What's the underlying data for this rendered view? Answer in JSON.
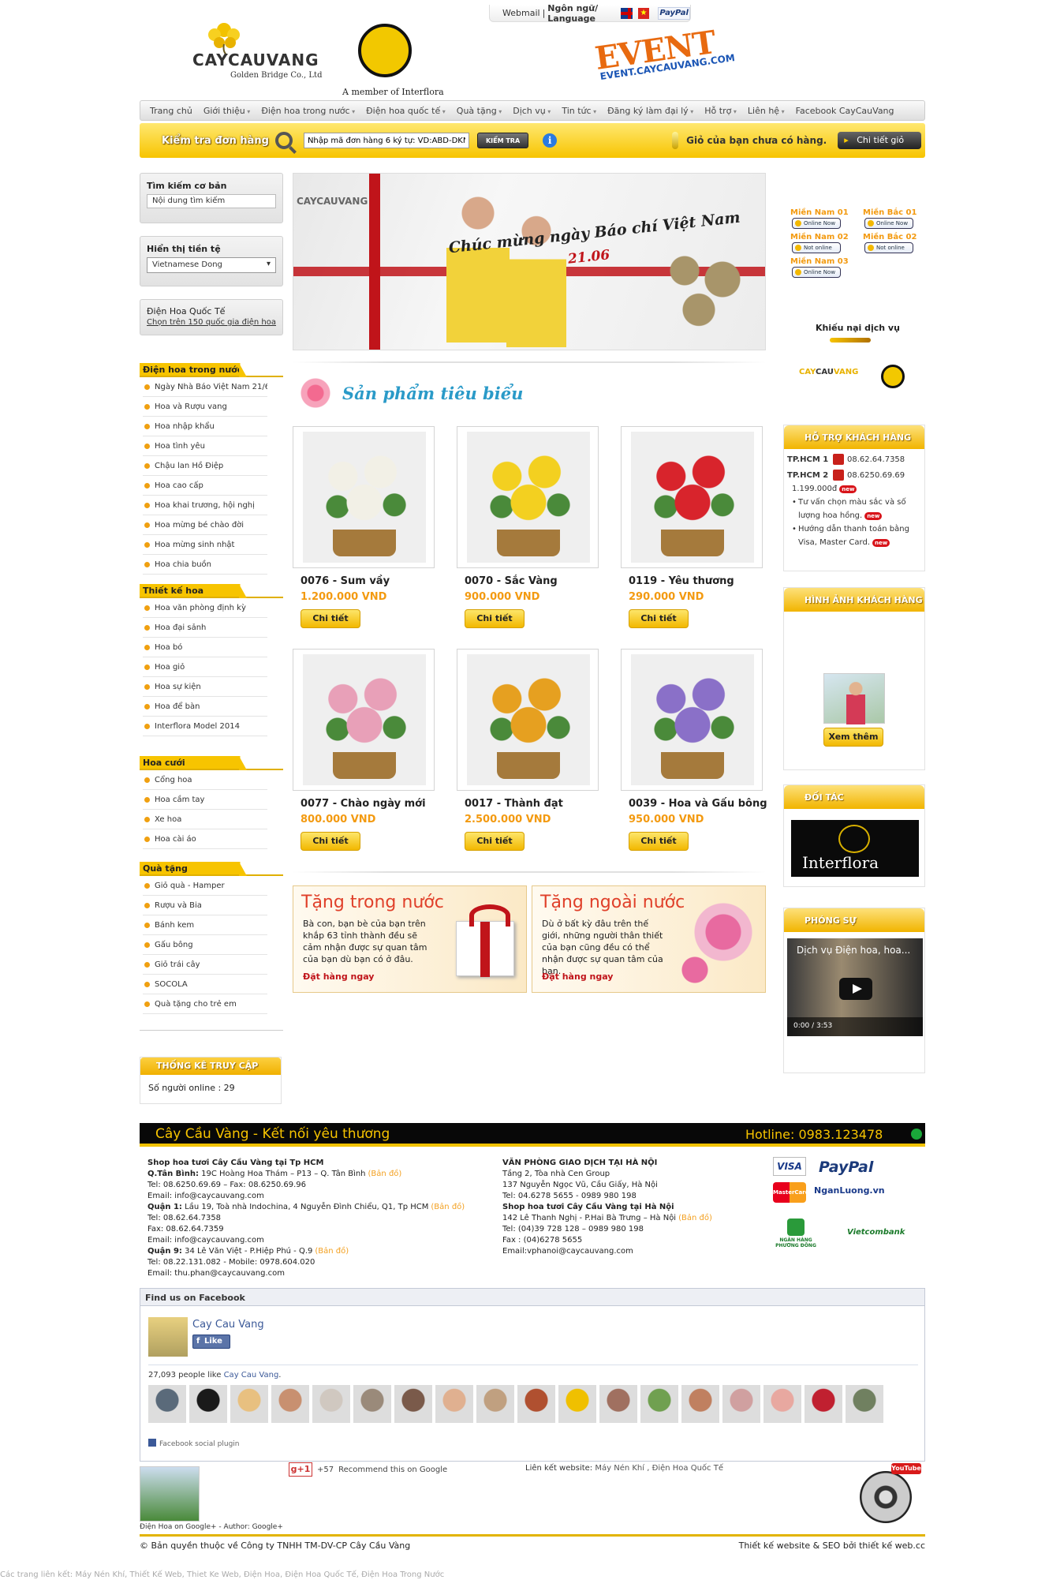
{
  "topbar": {
    "webmail": "Webmail",
    "language": "Ngôn ngữ/ Language",
    "paypal": "PayPal"
  },
  "header": {
    "logo_main": "CAYCAUVANG",
    "logo_sub": "Golden Bridge Co., Ltd",
    "interflora_caption": "A member of Interflora",
    "event_logo": "EVENT",
    "event_url": "EVENT.CAYCAUVANG.COM"
  },
  "nav": [
    {
      "label": "Trang chủ",
      "dropdown": false
    },
    {
      "label": "Giới thiệu",
      "dropdown": true
    },
    {
      "label": "Điện hoa trong nước",
      "dropdown": true
    },
    {
      "label": "Điện hoa quốc tế",
      "dropdown": true
    },
    {
      "label": "Quà tặng",
      "dropdown": true
    },
    {
      "label": "Dịch vụ",
      "dropdown": true
    },
    {
      "label": "Tin tức",
      "dropdown": true
    },
    {
      "label": "Đăng ký làm đại lý",
      "dropdown": true
    },
    {
      "label": "Hỗ trợ",
      "dropdown": true
    },
    {
      "label": "Liên hệ",
      "dropdown": true
    },
    {
      "label": "Facebook CayCauVang",
      "dropdown": false
    }
  ],
  "order_bar": {
    "label": "Kiểm tra đơn hàng",
    "input_placeholder": "Nhập mã đơn hàng 6 ký tự: VD:ABD-DKN",
    "check_button": "KIỂM TRA",
    "cart_text": "Giỏ của bạn chưa có hàng.",
    "detail_button": "Chi tiết giỏ"
  },
  "sidebar": {
    "search_title": "Tìm kiếm cơ bản",
    "search_placeholder": "Nội dung tìm kiếm",
    "currency_title": "Hiển thị tiền tệ",
    "currency_value": "Vietnamese Dong",
    "intl_title": "Điện Hoa Quốc Tế",
    "intl_link": "Chọn trên 150 quốc gia điện hoa",
    "categories": [
      {
        "title": "Điện hoa trong nước",
        "items": [
          "Ngày Nhà Báo Việt Nam 21/6",
          "Hoa và Rượu vang",
          "Hoa nhập khẩu",
          "Hoa tình yêu",
          "Chậu lan Hồ Điệp",
          "Hoa cao cấp",
          "Hoa khai trương, hội nghị",
          "Hoa mừng bé chào đời",
          "Hoa mừng sinh nhật",
          "Hoa chia buồn"
        ]
      },
      {
        "title": "Thiết kế hoa",
        "items": [
          "Hoa văn phòng định kỳ",
          "Hoa đại sảnh",
          "Hoa bó",
          "Hoa giỏ",
          "Hoa sự kiện",
          "Hoa để bàn",
          "Interflora Model 2014"
        ]
      },
      {
        "title": "Hoa cưới",
        "items": [
          "Cổng hoa",
          "Hoa cầm tay",
          "Xe hoa",
          "Hoa cài áo"
        ]
      },
      {
        "title": "Quà tặng",
        "items": [
          "Giỏ quà - Hamper",
          "Rượu và Bia",
          "Bánh kem",
          "Gấu bông",
          "Giỏ trái cây",
          "SOCOLA",
          "Quà tặng cho trẻ em"
        ]
      }
    ],
    "stats_title": "THỐNG KÊ TRUY CẬP",
    "stats_online": "Số người online : 29"
  },
  "banner": {
    "brand": "CAYCAUVANG",
    "message": "Chúc mừng ngày Báo chí Việt Nam",
    "date": "21.06"
  },
  "support_status": [
    {
      "name": "Miền Nam 01",
      "status": "Online Now"
    },
    {
      "name": "Miền Bắc 01",
      "status": "Online Now"
    },
    {
      "name": "Miền Nam 02",
      "status": "Not online"
    },
    {
      "name": "Miền Bắc 02",
      "status": "Not online"
    },
    {
      "name": "Miền Nam 03",
      "status": "Online Now"
    }
  ],
  "complaint": "Khiếu nại dịch vụ",
  "products_title": "Sản phẩm tiêu biểu",
  "products": [
    {
      "name": "0076 - Sum vầy",
      "price": "1.200.000 VND",
      "button": "Chi tiết",
      "color": "#f2f0e6"
    },
    {
      "name": "0070 - Sắc Vàng",
      "price": "900.000 VND",
      "button": "Chi tiết",
      "color": "#f3d020"
    },
    {
      "name": "0119 - Yêu thương",
      "price": "290.000 VND",
      "button": "Chi tiết",
      "color": "#d8242c"
    },
    {
      "name": "0077 - Chào ngày mới",
      "price": "800.000 VND",
      "button": "Chi tiết",
      "color": "#e8a0b8"
    },
    {
      "name": "0017 - Thành đạt",
      "price": "2.500.000 VND",
      "button": "Chi tiết",
      "color": "#e6a020"
    },
    {
      "name": "0039 - Hoa và Gấu bông",
      "price": "950.000 VND",
      "button": "Chi tiết",
      "color": "#8a70c8"
    }
  ],
  "gifts": [
    {
      "title": "Tặng trong nước",
      "desc": "Bà con, bạn bè của bạn trên khắp 63 tỉnh thành đều sẽ cảm nhận được sự quan tâm của bạn dù bạn có ở đâu.",
      "cta": "Đặt hàng ngay"
    },
    {
      "title": "Tặng ngoài nước",
      "desc": "Dù ở bất kỳ đâu trên thế giới, những người thân thiết của bạn cũng đều có thể nhận được sự quan tâm của bạn.",
      "cta": "Đặt hàng ngay"
    }
  ],
  "right": {
    "support_title": "HỖ TRỢ KHÁCH HÀNG",
    "hotlines": [
      {
        "label": "TP.HCM 1",
        "phone": "08.62.64.7358"
      },
      {
        "label": "TP.HCM 2",
        "phone": "08.6250.69.69"
      }
    ],
    "support_items": [
      "1.199.000đ",
      "Tư vấn chọn màu sắc và số lượng hoa hồng.",
      "Hướng dẫn thanh toán bằng Visa, Master Card."
    ],
    "new_badge": "new",
    "customers_title": "HÌNH ẢNH KHÁCH HÀNG",
    "more_button": "Xem thêm",
    "partners_title": "ĐỐI TÁC",
    "partner_name": "Interflora",
    "report_title": "PHÓNG SỰ",
    "video_title": "Dịch vụ Điện hoa, hoa...",
    "video_time": "0:00 / 3:53"
  },
  "footer": {
    "slogan": "Cây Cầu Vàng - Kết nối yêu thương",
    "hotline": "Hotline: 0983.123478",
    "hcm": [
      {
        "bold": "Shop hoa tươi Cây Cầu Vàng tại Tp HCM",
        "text": ""
      },
      {
        "bold": "Q.Tân Bình:",
        "text": " 19C Hoàng Hoa Thám – P13 – Q. Tân Bình",
        "map": "(Bản đồ)"
      },
      {
        "bold": "",
        "text": "Tel: 08.6250.69.69 – Fax: 08.6250.69.96"
      },
      {
        "bold": "",
        "text": "Email: info@caycauvang.com"
      },
      {
        "bold": "Quận 1:",
        "text": " Lầu 19, Toà nhà Indochina, 4 Nguyễn Đình Chiểu, Q1, Tp HCM",
        "map": "(Bản đồ)"
      },
      {
        "bold": "",
        "text": "Tel: 08.62.64.7358"
      },
      {
        "bold": "",
        "text": "Fax: 08.62.64.7359"
      },
      {
        "bold": "",
        "text": "Email: info@caycauvang.com"
      },
      {
        "bold": "Quận 9:",
        "text": " 34 Lê Văn Việt - P.Hiệp Phú - Q.9",
        "map": "(Bản đồ)"
      },
      {
        "bold": "",
        "text": "Tel: 08.22.131.082 - Mobile: 0978.604.020"
      },
      {
        "bold": "",
        "text": "Email: thu.phan@caycauvang.com"
      }
    ],
    "hn": [
      {
        "bold": "VĂN PHÒNG GIAO DỊCH TẠI HÀ NỘI",
        "text": ""
      },
      {
        "bold": "",
        "text": "Tầng 2, Tòa nhà Cen Group"
      },
      {
        "bold": "",
        "text": "137 Nguyễn Ngọc Vũ, Cầu Giấy, Hà Nội"
      },
      {
        "bold": "",
        "text": "Tel: 04.6278 5655 - 0989 980 198"
      },
      {
        "bold": "Shop hoa tươi Cây Cầu Vàng tại Hà Nội",
        "text": ""
      },
      {
        "bold": "",
        "text": "142 Lê Thanh Nghị - P.Hai Bà Trưng – Hà Nội",
        "map": "(Bản đồ)"
      },
      {
        "bold": "",
        "text": "Tel: (04)39 728 128 – 0989 980 198"
      },
      {
        "bold": "",
        "text": "Fax : (04)6278 5655"
      },
      {
        "bold": "",
        "text": "Email:vphanoi@caycauvang.com"
      }
    ],
    "payments": {
      "visa": "VISA",
      "paypal": "PayPal",
      "mastercard": "MasterCard",
      "nganluong": "NganLuong.vn",
      "bank1": "NGÂN HÀNG PHƯƠNG ĐÔNG",
      "bank2": "Vietcombank"
    }
  },
  "facebook": {
    "header": "Find us on Facebook",
    "page_name": "Cay Cau Vang",
    "like": "Like",
    "count_text": "27,093 people like ",
    "count_link": "Cay Cau Vang",
    "plugin": "Facebook social plugin",
    "faces": [
      "#5a6a7a",
      "#1a1a1a",
      "#e8c080",
      "#c89070",
      "#d0c8c0",
      "#9a8a7a",
      "#7a5a4a",
      "#e0b090",
      "#c0a080",
      "#b05030",
      "#f0c000",
      "#a07060",
      "#70a050",
      "#c08060",
      "#d0a0a0",
      "#e8a8a0",
      "#c02030",
      "#708060"
    ]
  },
  "gplus": {
    "count": "+57",
    "text": "Recommend this on Google",
    "button": "g+1",
    "caption": "Điện Hoa on Google+ - Author: Google+"
  },
  "links": {
    "label": "Liên kết website:",
    "value": "Máy Nén Khí , Điện Hoa Quốc Tế"
  },
  "youtube": "YouTube",
  "copyright": {
    "left": "© Bản quyền thuộc về Công ty TNHH TM-DV-CP Cây Cầu Vàng",
    "right_prefix": "Thiết kế website & SEO bởi",
    "right_link": " thiết kế web.cc"
  },
  "footer_keywords": "Các trang liên kết: Máy Nén Khí, Thiết Kế Web, Thiet Ke Web, Điện Hoa, Điện Hoa Quốc Tế, Điện Hoa Trong Nước"
}
